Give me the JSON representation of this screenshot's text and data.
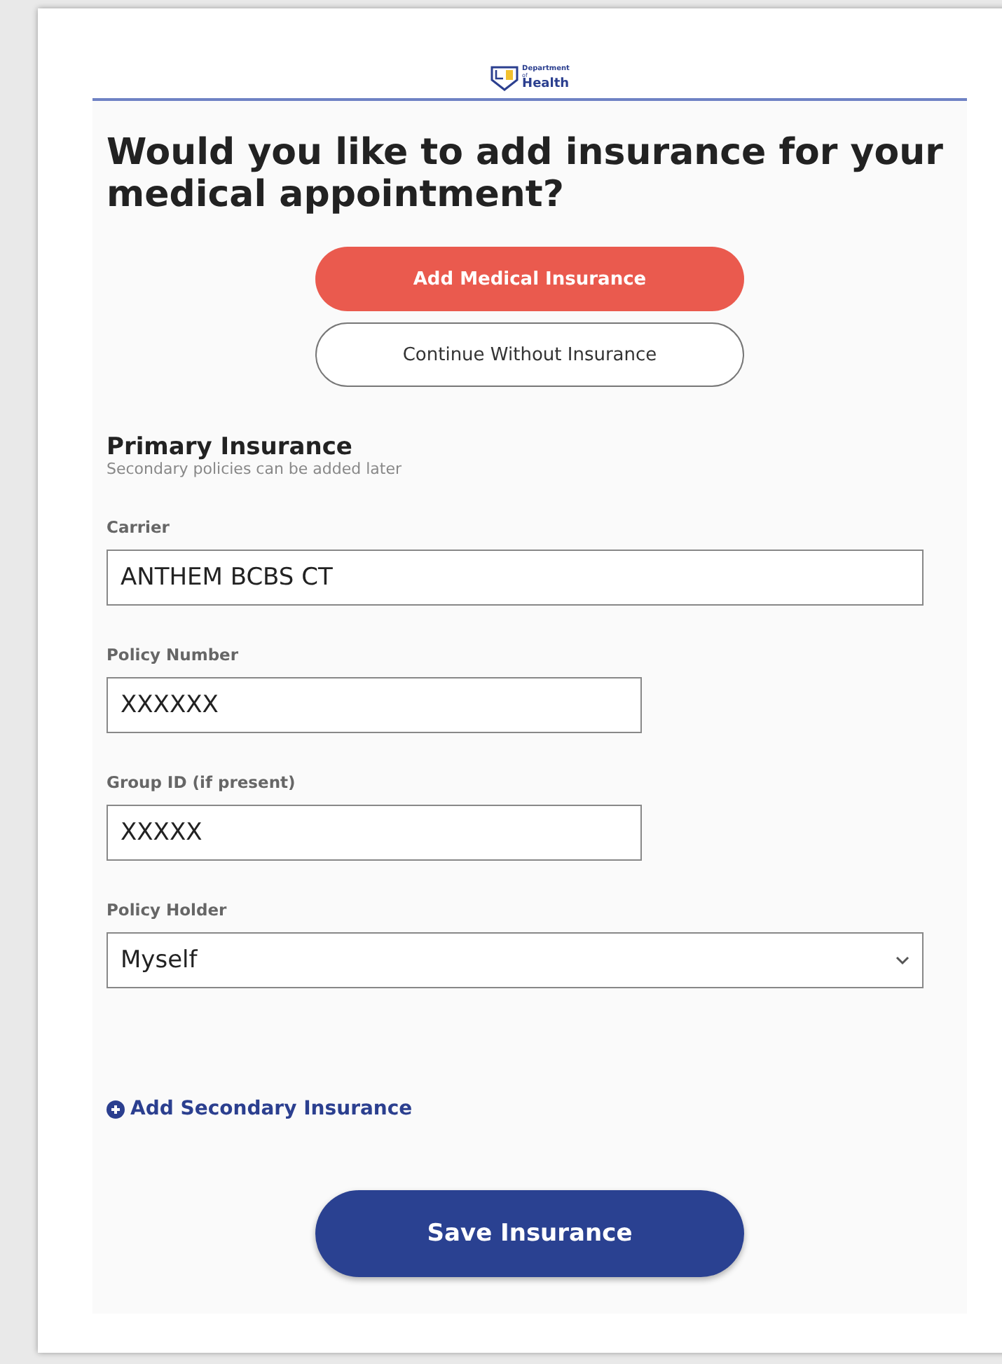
{
  "logo": {
    "lines": [
      "Department",
      "of",
      "Health"
    ]
  },
  "question": "Would you like to add insurance for your medical appointment?",
  "choices": [
    {
      "label": "Add Medical Insurance",
      "selected": true
    },
    {
      "label": "Continue Without Insurance",
      "selected": false
    }
  ],
  "section": {
    "title": "Primary Insurance",
    "subtitle": "Secondary policies can be added later"
  },
  "fields": [
    {
      "kind": "text",
      "label": "Carrier",
      "value": "ANTHEM BCBS CT",
      "wide": true
    },
    {
      "kind": "text",
      "label": "Policy Number",
      "value": "XXXXXX",
      "wide": false
    },
    {
      "kind": "text",
      "label": "Group ID (if present)",
      "value": "XXXXX",
      "wide": false
    },
    {
      "kind": "select",
      "label": "Policy Holder",
      "value": "Myself",
      "wide": true
    }
  ],
  "add_link": "Add Secondary Insurance",
  "save_button": "Save Insurance"
}
